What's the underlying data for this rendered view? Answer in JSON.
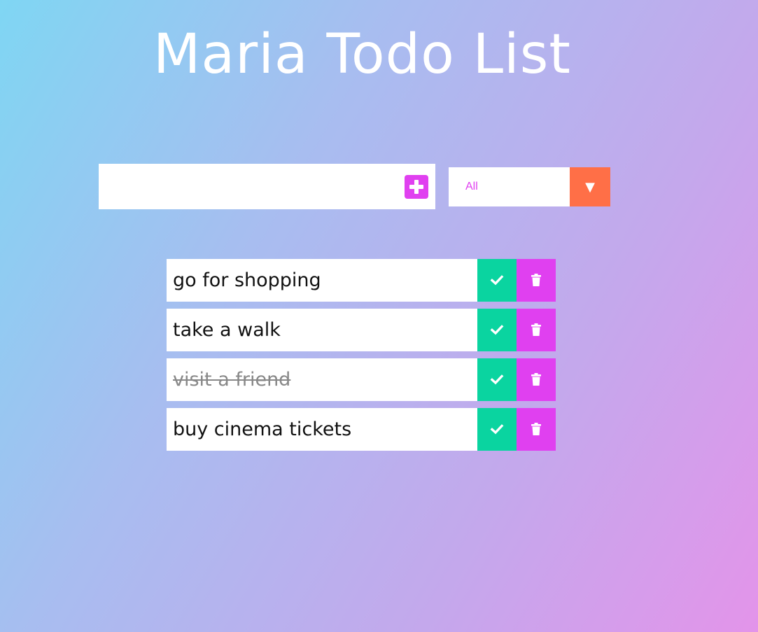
{
  "title": "Maria Todo List",
  "input": {
    "value": "",
    "placeholder": ""
  },
  "add_button": {
    "icon": "plus-square-icon"
  },
  "filter": {
    "selected": "All",
    "arrow": "▼"
  },
  "todos": [
    {
      "text": "go for shopping",
      "completed": false
    },
    {
      "text": "take a walk",
      "completed": false
    },
    {
      "text": "visit a friend",
      "completed": true
    },
    {
      "text": "buy cinema tickets",
      "completed": false
    }
  ],
  "colors": {
    "accent_pink": "#e040f0",
    "check_green": "#0ad4a0",
    "filter_orange": "#ff6f47"
  }
}
